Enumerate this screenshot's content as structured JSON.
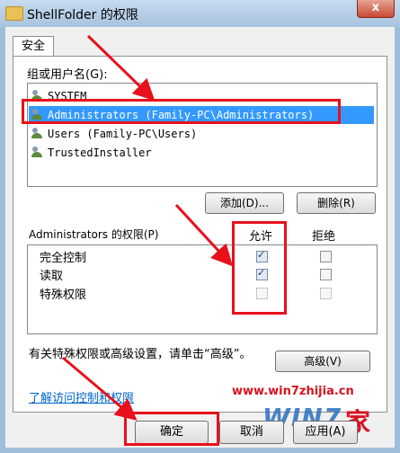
{
  "window": {
    "title": "ShellFolder 的权限",
    "close_label": "x"
  },
  "tab": {
    "label": "安全"
  },
  "group_label": "组或用户名(G):",
  "users": [
    "SYSTEM",
    "Administrators (Family-PC\\Administrators)",
    "Users (Family-PC\\Users)",
    "TrustedInstaller"
  ],
  "selected_user_index": 1,
  "buttons": {
    "add": "添加(D)...",
    "remove": "删除(R)",
    "advanced": "高级(V)",
    "ok": "确定",
    "cancel": "取消",
    "apply": "应用(A)"
  },
  "permissions": {
    "header_label": "Administrators 的权限(P)",
    "allow_header": "允许",
    "deny_header": "拒绝",
    "rows": [
      {
        "name": "完全控制",
        "allow": "checked",
        "deny": "unchecked"
      },
      {
        "name": "读取",
        "allow": "checked",
        "deny": "unchecked"
      },
      {
        "name": "特殊权限",
        "allow": "disabled",
        "deny": "disabled"
      }
    ]
  },
  "advanced_text": "有关特殊权限或高级设置，请单击“高级”。",
  "help_link": "了解访问控制和权限",
  "watermark": {
    "url": "www.win7zhijia.cn",
    "logo": "WIN7",
    "logo_char": "家"
  },
  "colors": {
    "highlight": "#e8101b",
    "selection": "#3399ff"
  }
}
